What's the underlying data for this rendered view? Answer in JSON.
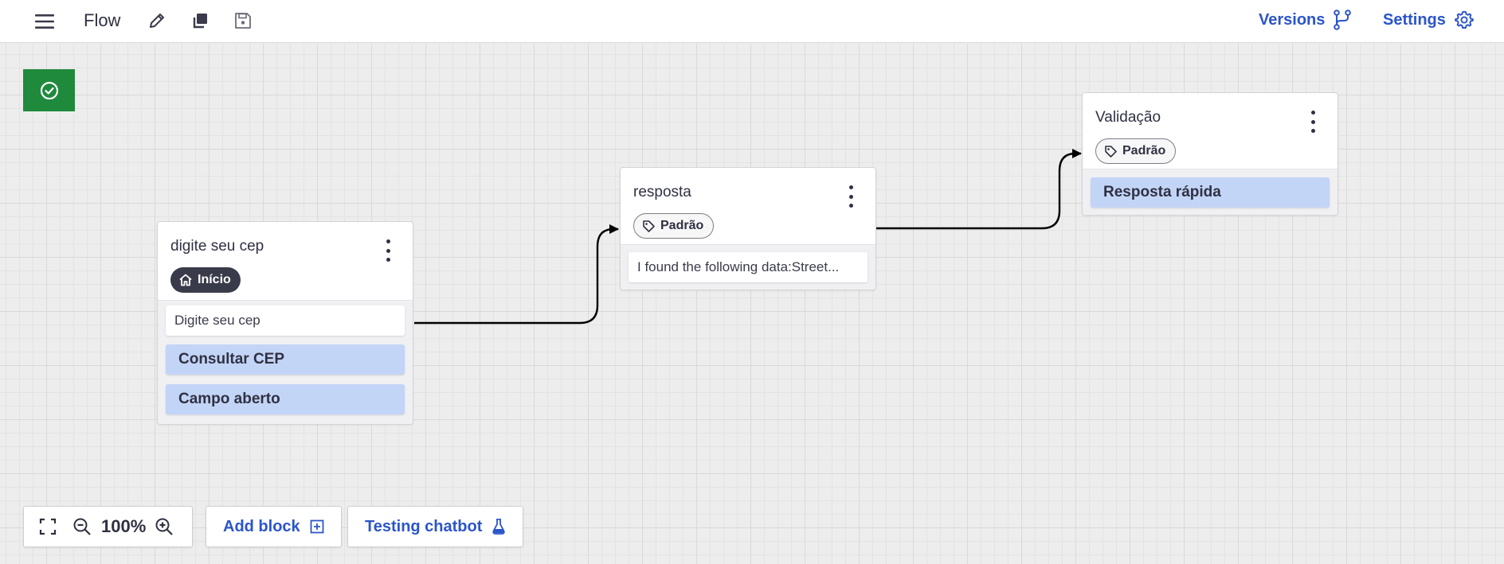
{
  "header": {
    "title": "Flow",
    "versions_label": "Versions",
    "settings_label": "Settings"
  },
  "colors": {
    "accent": "#2b55c9",
    "status_green": "#1f8a3c",
    "option_fill": "#c3d5f7",
    "start_tag": "#3a3b4a"
  },
  "blocks": [
    {
      "title": "digite seu cep",
      "tag": {
        "label": "Início",
        "icon": "home-icon"
      },
      "message": "Digite seu cep",
      "options": [
        "Consultar CEP",
        "Campo aberto"
      ]
    },
    {
      "title": "resposta",
      "tag": {
        "label": "Padrão",
        "icon": "tag-icon"
      },
      "message": "I found the following data:Street...",
      "options": []
    },
    {
      "title": "Validação",
      "tag": {
        "label": "Padrão",
        "icon": "tag-icon"
      },
      "message": "",
      "options": [
        "Resposta rápida"
      ]
    }
  ],
  "toolbar": {
    "zoom": "100%",
    "add_block_label": "Add block",
    "testing_label": "Testing chatbot"
  }
}
